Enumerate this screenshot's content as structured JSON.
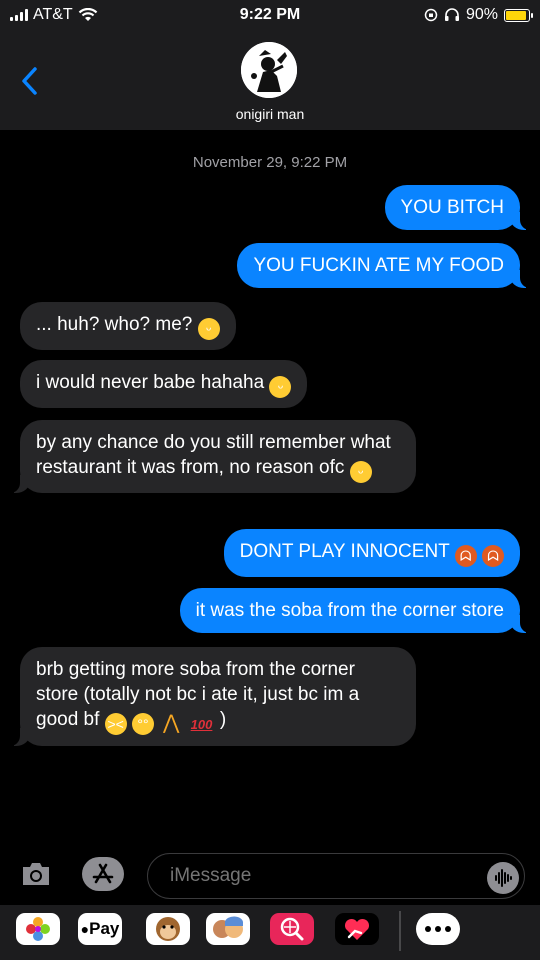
{
  "status_bar": {
    "carrier": "AT&T",
    "time": "9:22 PM",
    "battery": "90%",
    "battery_level": 0.9
  },
  "contact": {
    "name": "onigiri man",
    "back_icon": "chevron-left-icon"
  },
  "thread": {
    "timestamp": "November 29, 9:22 PM",
    "messages": [
      {
        "from": "me",
        "text": "YOU BITCH",
        "emoji": []
      },
      {
        "from": "me",
        "text": "YOU FUCKIN ATE MY FOOD",
        "emoji": []
      },
      {
        "from": "them",
        "text": "... huh? who? me?",
        "emoji": [
          "grinning-face"
        ]
      },
      {
        "from": "them",
        "text": "i would never babe hahaha",
        "emoji": [
          "grinning-face"
        ]
      },
      {
        "from": "them",
        "text": "by any chance do you still remember what restaurant it was from, no reason ofc",
        "emoji": [
          "grinning-face"
        ]
      },
      {
        "from": "me",
        "text": "DONT PLAY INNOCENT",
        "emoji": [
          "cursing-face",
          "cursing-face"
        ]
      },
      {
        "from": "me",
        "text": "it was the soba from the corner store",
        "emoji": []
      },
      {
        "from": "them",
        "text": "brb getting more soba from the corner store (totally not bc i ate it, just bc im a good bf",
        "emoji": [
          "persevering-face",
          "rolling-eyes-face",
          "folded-hands",
          "hundred-points"
        ],
        "suffix": ")"
      }
    ]
  },
  "compose": {
    "placeholder": "iMessage",
    "camera_icon": "camera-icon",
    "apps_icon": "app-store-icon",
    "audio_icon": "audio-waveform-icon"
  },
  "app_drawer": {
    "apple_pay_label": "Pay",
    "apps": [
      "photos-icon",
      "apple-pay-icon",
      "animoji-icon",
      "memoji-icon",
      "search-images-icon",
      "digital-touch-icon",
      "more-apps-icon"
    ]
  },
  "colors": {
    "sent_bubble": "#0a84ff",
    "received_bubble": "#262628",
    "header_bg": "#1c1c1e",
    "battery_fill": "#ffd60a"
  }
}
